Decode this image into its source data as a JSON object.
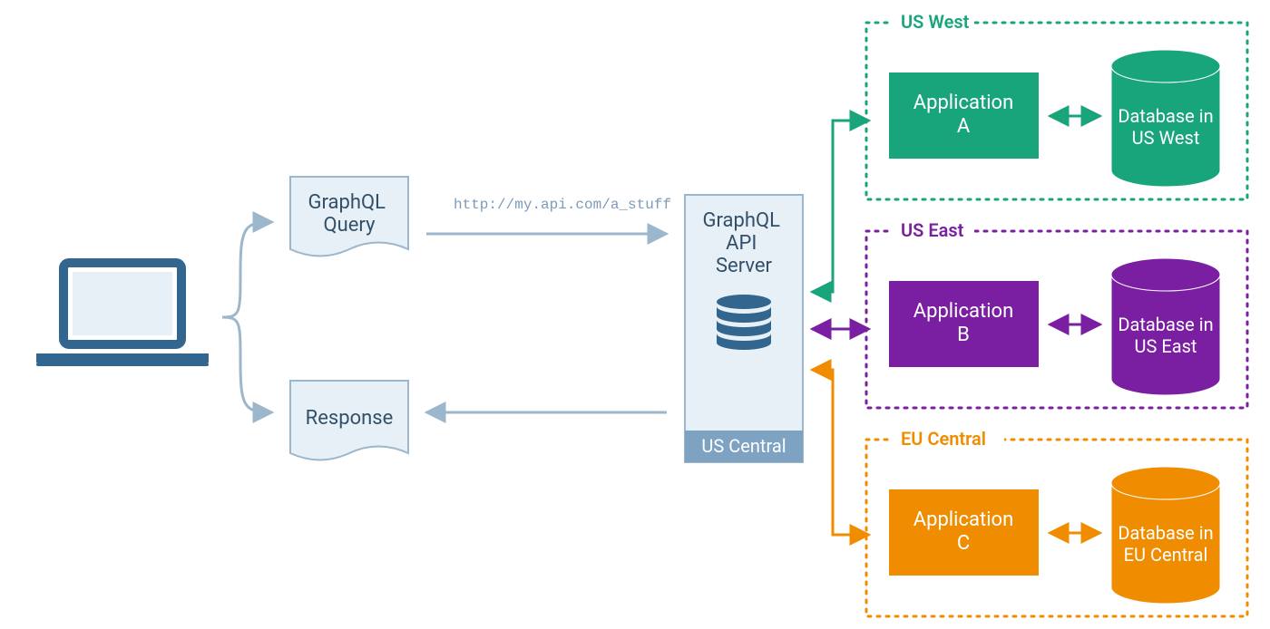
{
  "query_label": "GraphQL\nQuery",
  "response_label": "Response",
  "url_label": "http://my.api.com/a_stuff",
  "server_label": "GraphQL\nAPI\nServer",
  "server_region": "US Central",
  "regions": [
    {
      "id": "uswest",
      "name": "US West",
      "app": "Application\nA",
      "db": "Database in\nUS West",
      "color": "#19a57b"
    },
    {
      "id": "useast",
      "name": "US East",
      "app": "Application\nB",
      "db": "Database in\nUS East",
      "color": "#7a1fa2"
    },
    {
      "id": "eucentral",
      "name": "EU Central",
      "app": "Application\nC",
      "db": "Database in\nEU Central",
      "color": "#f08c00"
    }
  ],
  "colors": {
    "panel": "#e8f0f7",
    "stroke": "#9cb6cb",
    "darktext": "#33506b",
    "server_fill": "#33668f",
    "server_region_bg": "#7ea3c2"
  }
}
